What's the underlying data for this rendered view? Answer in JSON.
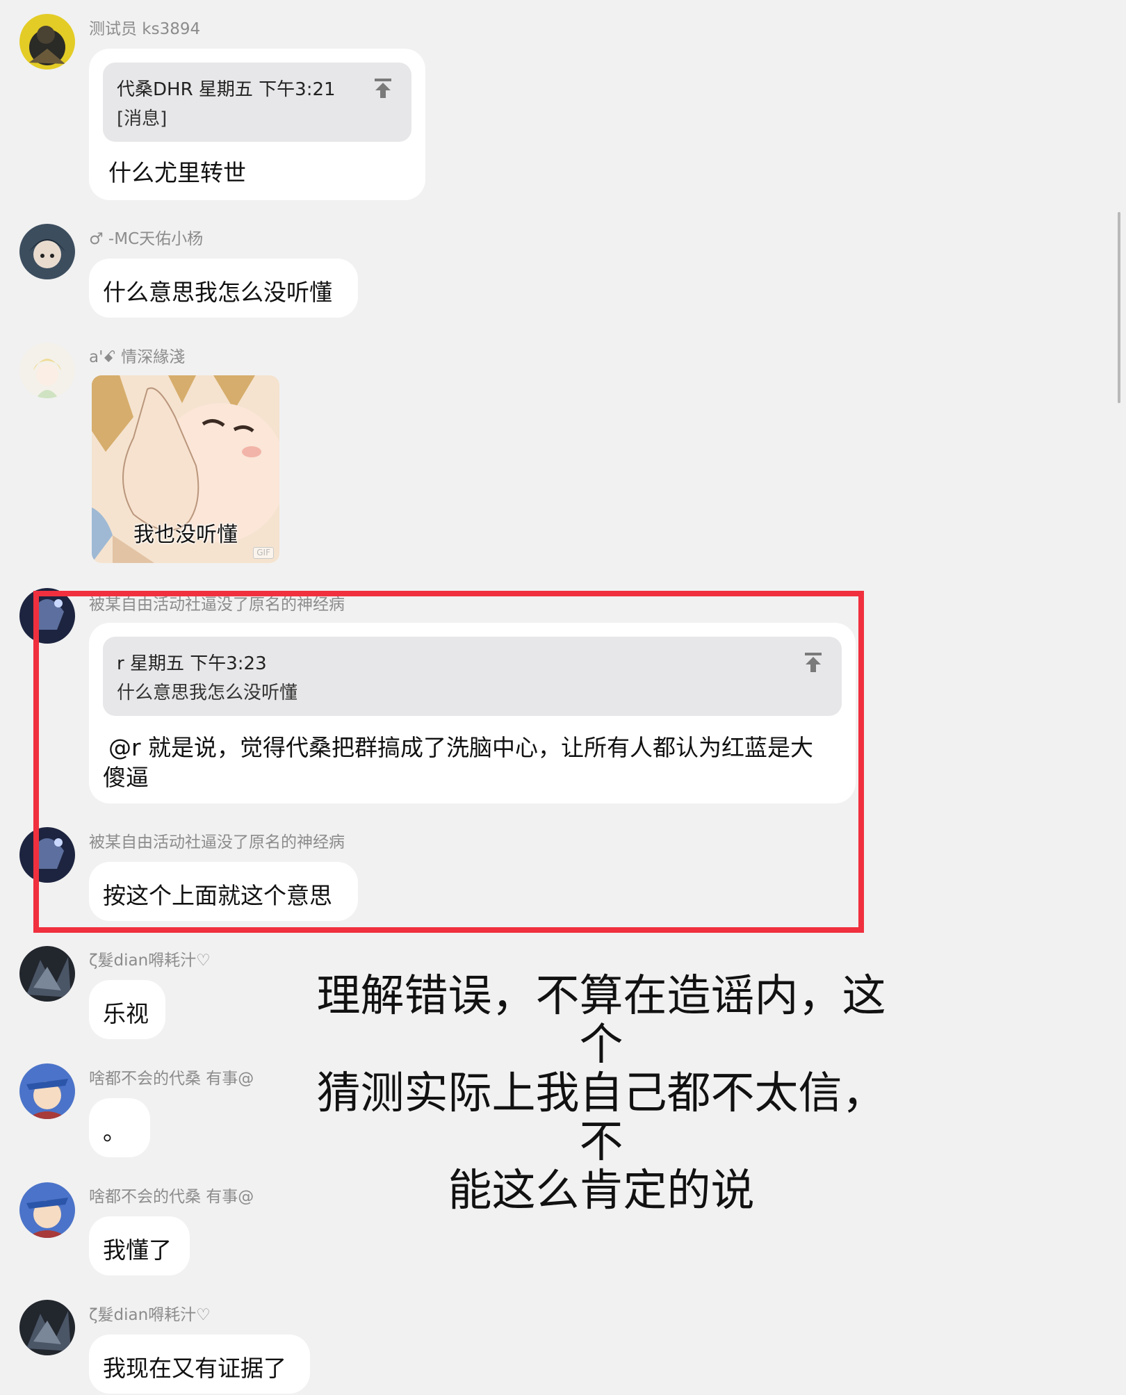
{
  "messages": [
    {
      "nick": "测试员 ks3894",
      "quote": {
        "header": "代桑DHR 星期五 下午3:21",
        "body": "[消息]"
      },
      "text": "什么尤里转世"
    },
    {
      "nick": "♂ -MC天佑小杨",
      "text": "什么意思我怎么没听懂"
    },
    {
      "nick": "a'ꗃ 情深緣淺",
      "gif_caption": "我也没听懂",
      "gif_badge": "GIF"
    },
    {
      "nick": "被某自由活动社逼没了原名的神经病",
      "quote": {
        "header": "r 星期五 下午3:23",
        "body": "什么意思我怎么没听懂"
      },
      "text_line1": "@r 就是说，觉得代桑把群搞成了洗脑中心，让所有人都认为红蓝是大",
      "text_line2": "傻逼"
    },
    {
      "nick": "被某自由活动社逼没了原名的神经病",
      "text": "按这个上面就这个意思"
    },
    {
      "nick": "ζ髮dian嘚耗汁♡",
      "text": "乐视"
    },
    {
      "nick": "啥都不会的代桑 有事@",
      "text": "。"
    },
    {
      "nick": "啥都不会的代桑 有事@",
      "text": "我懂了"
    },
    {
      "nick": "ζ髮dian嘚耗汁♡",
      "text": "我现在又有证据了"
    }
  ],
  "overlay": {
    "line1": "理解错误，不算在造谣内，这个",
    "line2": "猜测实际上我自己都不太信，不",
    "line3": "能这么肯定的说"
  },
  "colors": {
    "highlight": "#f0303e",
    "background": "#f1f1f1",
    "bubble": "#ffffff",
    "quote": "#e7e7e9"
  }
}
